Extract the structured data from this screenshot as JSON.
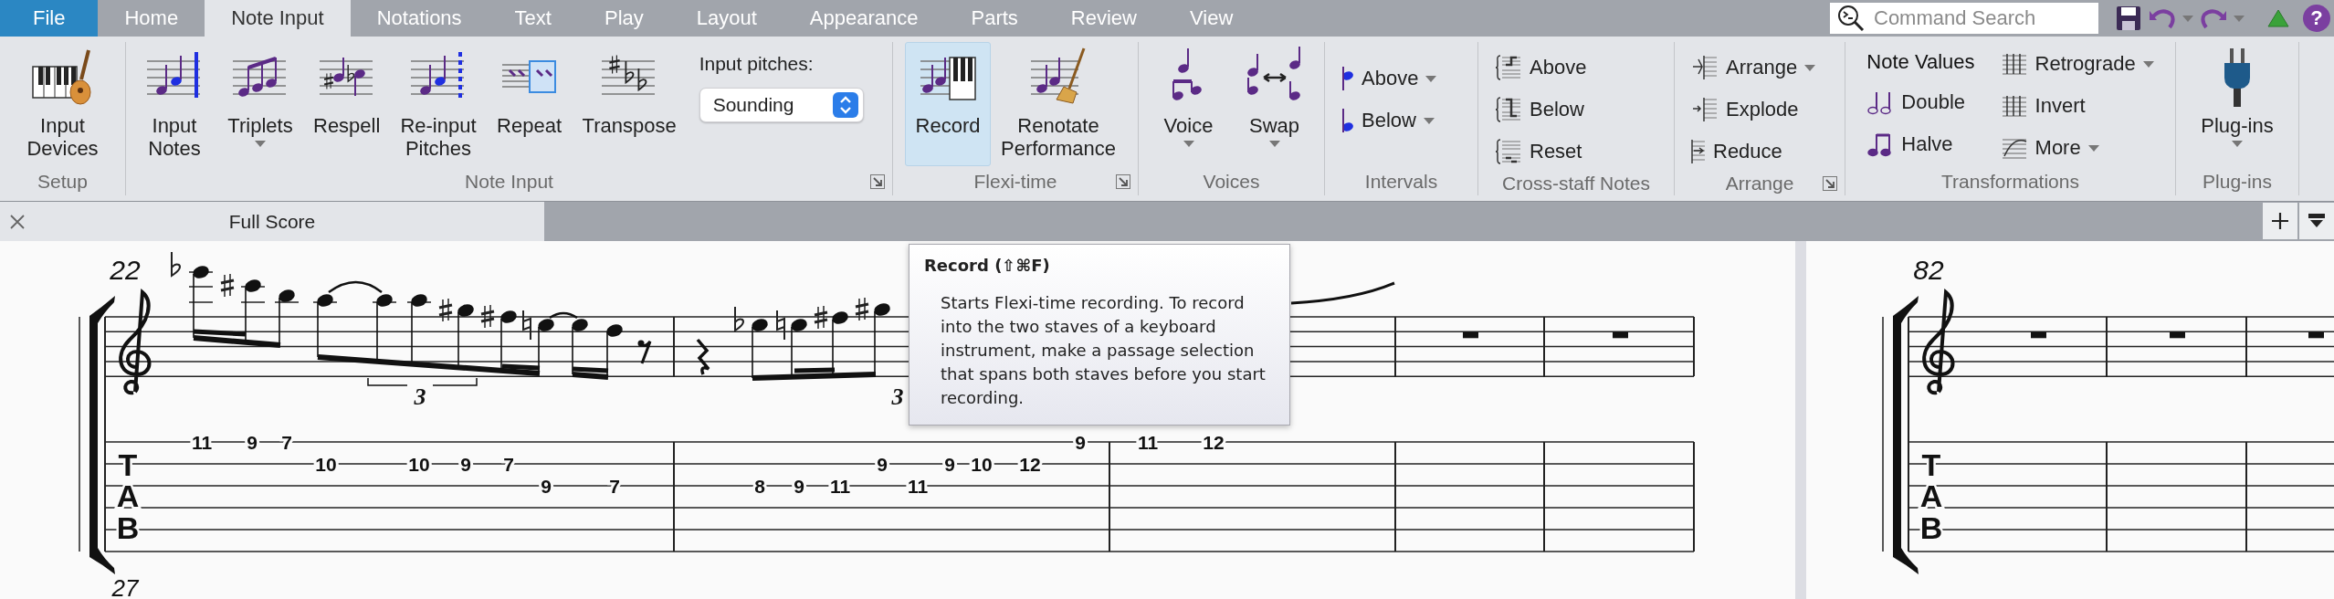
{
  "menu_tabs": [
    {
      "label": "File",
      "kind": "file",
      "selected": false
    },
    {
      "label": "Home",
      "kind": "tab",
      "selected": false
    },
    {
      "label": "Note Input",
      "kind": "tab",
      "selected": true
    },
    {
      "label": "Notations",
      "kind": "tab",
      "selected": false
    },
    {
      "label": "Text",
      "kind": "tab",
      "selected": false
    },
    {
      "label": "Play",
      "kind": "tab",
      "selected": false
    },
    {
      "label": "Layout",
      "kind": "tab",
      "selected": false
    },
    {
      "label": "Appearance",
      "kind": "tab",
      "selected": false
    },
    {
      "label": "Parts",
      "kind": "tab",
      "selected": false
    },
    {
      "label": "Review",
      "kind": "tab",
      "selected": false
    },
    {
      "label": "View",
      "kind": "tab",
      "selected": false
    }
  ],
  "command_search": {
    "placeholder": "Command Search"
  },
  "help_label": "?",
  "ribbon_groups": [
    {
      "label": "Setup",
      "kind": "large",
      "buttons": [
        {
          "label": "Input\nDevices",
          "menu": false,
          "hovered": false
        }
      ]
    },
    {
      "label": "Note Input",
      "kind": "large",
      "launcher": true,
      "buttons": [
        {
          "label": "Input\nNotes",
          "menu": false,
          "hovered": false
        },
        {
          "label": "Triplets",
          "menu": true,
          "hovered": false
        },
        {
          "label": "Respell",
          "menu": false,
          "hovered": false
        },
        {
          "label": "Re-input\nPitches",
          "menu": false,
          "hovered": false
        },
        {
          "label": "Repeat",
          "menu": false,
          "hovered": false
        },
        {
          "label": "Transpose",
          "menu": false,
          "hovered": false
        }
      ],
      "pitch_selector": {
        "label": "Input pitches:",
        "value": "Sounding"
      }
    },
    {
      "label": "Flexi-time",
      "kind": "large",
      "launcher": true,
      "buttons": [
        {
          "label": "Record",
          "menu": false,
          "hovered": true
        },
        {
          "label": "Renotate\nPerformance",
          "menu": false,
          "hovered": false
        }
      ]
    },
    {
      "label": "Voices",
      "kind": "large",
      "buttons": [
        {
          "label": "Voice",
          "menu": true,
          "hovered": false
        },
        {
          "label": "Swap",
          "menu": true,
          "hovered": false
        }
      ]
    },
    {
      "label": "Intervals",
      "kind": "small",
      "buttons": [
        {
          "label": "Above",
          "menu": true
        },
        {
          "label": "Below",
          "menu": true
        }
      ]
    },
    {
      "label": "Cross-staff Notes",
      "kind": "small",
      "buttons": [
        {
          "label": "Above",
          "menu": false
        },
        {
          "label": "Below",
          "menu": false
        },
        {
          "label": "Reset",
          "menu": false
        }
      ]
    },
    {
      "label": "Arrange",
      "kind": "small",
      "launcher": true,
      "buttons": [
        {
          "label": "Arrange",
          "menu": true
        },
        {
          "label": "Explode",
          "menu": false
        },
        {
          "label": "Reduce",
          "menu": false
        }
      ]
    },
    {
      "label": "Transformations",
      "kind": "columns",
      "columns": [
        {
          "heading": "Note Values",
          "buttons": [
            {
              "label": "Double",
              "menu": false
            },
            {
              "label": "Halve",
              "menu": false
            }
          ]
        },
        {
          "buttons": [
            {
              "label": "Retrograde",
              "menu": true
            },
            {
              "label": "Invert",
              "menu": false
            },
            {
              "label": "More",
              "menu": true
            }
          ]
        }
      ]
    },
    {
      "label": "Plug-ins",
      "kind": "large",
      "buttons": [
        {
          "label": "Plug-ins",
          "menu": true,
          "hovered": false
        }
      ]
    }
  ],
  "document_tabs": [
    {
      "label": "Full Score",
      "selected": true
    }
  ],
  "score": {
    "systems": [
      {
        "measure_number": "22",
        "tab_letters": [
          "T",
          "A",
          "B"
        ],
        "tuplets": [
          "3",
          "3"
        ],
        "tab_lines": [
          {
            "frets": [
              "11",
              "9",
              "7",
              "9",
              "11",
              "12"
            ]
          },
          {
            "frets": [
              "10",
              "10",
              "9",
              "7",
              "9",
              "9",
              "10",
              "12"
            ]
          },
          {
            "frets": [
              "9",
              "7",
              "8",
              "9",
              "11",
              "11"
            ]
          }
        ]
      },
      {
        "measure_number": "82",
        "tab_letters": [
          "T",
          "A",
          "B"
        ]
      }
    ],
    "next_measure_number": "27"
  },
  "tooltip": {
    "title": "Record (⇧⌘F)",
    "body": "Starts Flexi-time recording. To record into the two staves of a keyboard instrument, make a passage selection that spans both staves before you start recording."
  }
}
